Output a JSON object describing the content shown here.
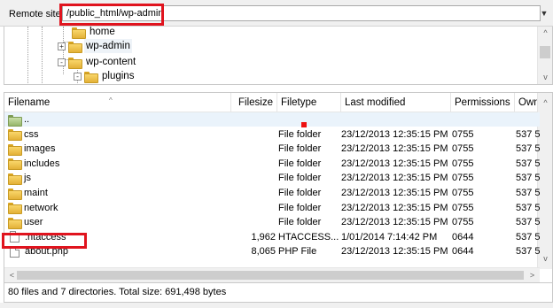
{
  "remote": {
    "label": "Remote site:",
    "path": "/public_html/wp-admin",
    "dropdown_icon": "chevron-down-icon"
  },
  "tree": {
    "items": [
      {
        "label": "home",
        "level": 2,
        "expander": ""
      },
      {
        "label": "wp-admin",
        "level": 2,
        "expander": "+"
      },
      {
        "label": "wp-content",
        "level": 2,
        "expander": "-"
      },
      {
        "label": "plugins",
        "level": 3,
        "expander": "-"
      }
    ]
  },
  "list": {
    "columns": [
      "Filename",
      "Filesize",
      "Filetype",
      "Last modified",
      "Permissions",
      "Owne"
    ],
    "rows": [
      {
        "name": "..",
        "size": "",
        "type": "",
        "modified": "",
        "perm": "",
        "owner": "",
        "icon": "parent-folder-icon"
      },
      {
        "name": "css",
        "size": "",
        "type": "File folder",
        "modified": "23/12/2013 12:35:15 PM",
        "perm": "0755",
        "owner": "537 5",
        "icon": "folder-icon"
      },
      {
        "name": "images",
        "size": "",
        "type": "File folder",
        "modified": "23/12/2013 12:35:15 PM",
        "perm": "0755",
        "owner": "537 5",
        "icon": "folder-icon"
      },
      {
        "name": "includes",
        "size": "",
        "type": "File folder",
        "modified": "23/12/2013 12:35:15 PM",
        "perm": "0755",
        "owner": "537 5",
        "icon": "folder-icon"
      },
      {
        "name": "js",
        "size": "",
        "type": "File folder",
        "modified": "23/12/2013 12:35:15 PM",
        "perm": "0755",
        "owner": "537 5",
        "icon": "folder-icon"
      },
      {
        "name": "maint",
        "size": "",
        "type": "File folder",
        "modified": "23/12/2013 12:35:15 PM",
        "perm": "0755",
        "owner": "537 5",
        "icon": "folder-icon"
      },
      {
        "name": "network",
        "size": "",
        "type": "File folder",
        "modified": "23/12/2013 12:35:15 PM",
        "perm": "0755",
        "owner": "537 5",
        "icon": "folder-icon"
      },
      {
        "name": "user",
        "size": "",
        "type": "File folder",
        "modified": "23/12/2013 12:35:15 PM",
        "perm": "0755",
        "owner": "537 5",
        "icon": "folder-icon"
      },
      {
        "name": ".htaccess",
        "size": "1,962",
        "type": "HTACCESS...",
        "modified": "1/01/2014 7:14:42 PM",
        "perm": "0644",
        "owner": "537 5",
        "icon": "file-icon"
      },
      {
        "name": "about.php",
        "size": "8,065",
        "type": "PHP File",
        "modified": "23/12/2013 12:35:15 PM",
        "perm": "0644",
        "owner": "537 5",
        "icon": "file-icon"
      }
    ]
  },
  "status": {
    "text": "80 files and 7 directories. Total size: 691,498 bytes"
  },
  "colors": {
    "highlight": "#e0141e",
    "folder": "#f2c94c",
    "selection": "#eaf3fb"
  }
}
